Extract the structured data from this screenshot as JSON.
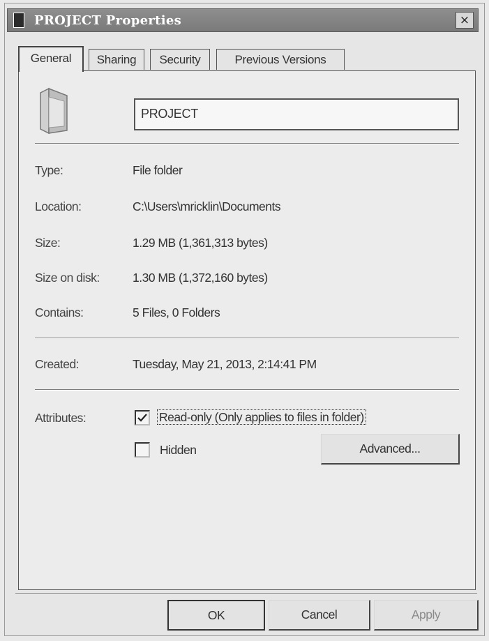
{
  "window": {
    "title": "PROJECT Properties",
    "close_glyph": "×"
  },
  "tabs": [
    {
      "label": "General",
      "active": true
    },
    {
      "label": "Sharing",
      "active": false
    },
    {
      "label": "Security",
      "active": false
    },
    {
      "label": "Previous Versions",
      "active": false
    }
  ],
  "general": {
    "icon": "folder-icon",
    "name_value": "PROJECT",
    "rows": [
      {
        "label": "Type:",
        "value": "File folder"
      },
      {
        "label": "Location:",
        "value": "C:\\Users\\mricklin\\Documents"
      },
      {
        "label": "Size:",
        "value": "1.29 MB (1,361,313 bytes)"
      },
      {
        "label": "Size on disk:",
        "value": "1.30 MB (1,372,160 bytes)"
      },
      {
        "label": "Contains:",
        "value": "5 Files, 0 Folders"
      }
    ],
    "created_label": "Created:",
    "created_value": "Tuesday, May 21, 2013, 2:14:41 PM",
    "attributes_label": "Attributes:",
    "readonly": {
      "checked": true,
      "label": "Read-only (Only applies to files in folder)"
    },
    "hidden": {
      "checked": false,
      "label": "Hidden"
    },
    "advanced_label": "Advanced..."
  },
  "buttons": {
    "ok": "OK",
    "cancel": "Cancel",
    "apply": "Apply"
  }
}
